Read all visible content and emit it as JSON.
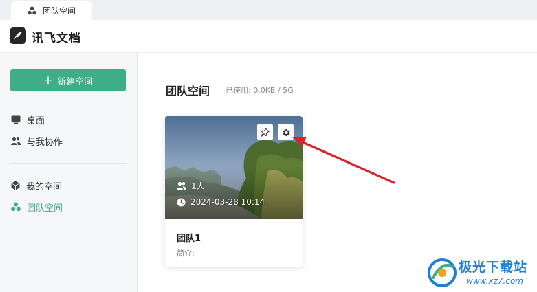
{
  "tab": {
    "label": "团队空间",
    "icon": "team-icon"
  },
  "header": {
    "brand": "讯飞文档",
    "icon": "feather-logo-icon"
  },
  "sidebar": {
    "new_button": {
      "label": "新建空间",
      "icon": "plus-icon"
    },
    "items": [
      {
        "label": "桌面",
        "icon": "monitor-icon",
        "active": false
      },
      {
        "label": "与我协作",
        "icon": "users-icon",
        "active": false
      },
      {
        "label": "我的空间",
        "icon": "cube-icon",
        "active": false
      },
      {
        "label": "团队空间",
        "icon": "team-icon",
        "active": true
      }
    ]
  },
  "main": {
    "title": "团队空间",
    "usage": "已使用: 0.0KB  /  5G",
    "cards": [
      {
        "members": "1人",
        "created": "2024-03-28 10:14",
        "name": "团队1",
        "desc": "简介:",
        "actions": [
          "pin-icon",
          "gear-icon"
        ]
      }
    ]
  },
  "watermark": {
    "title": "极光下载站",
    "url": "www.xz7.com"
  },
  "colors": {
    "accent": "#3dae85",
    "annotation_arrow": "#d9232b",
    "watermark": "#1f7fd1"
  }
}
